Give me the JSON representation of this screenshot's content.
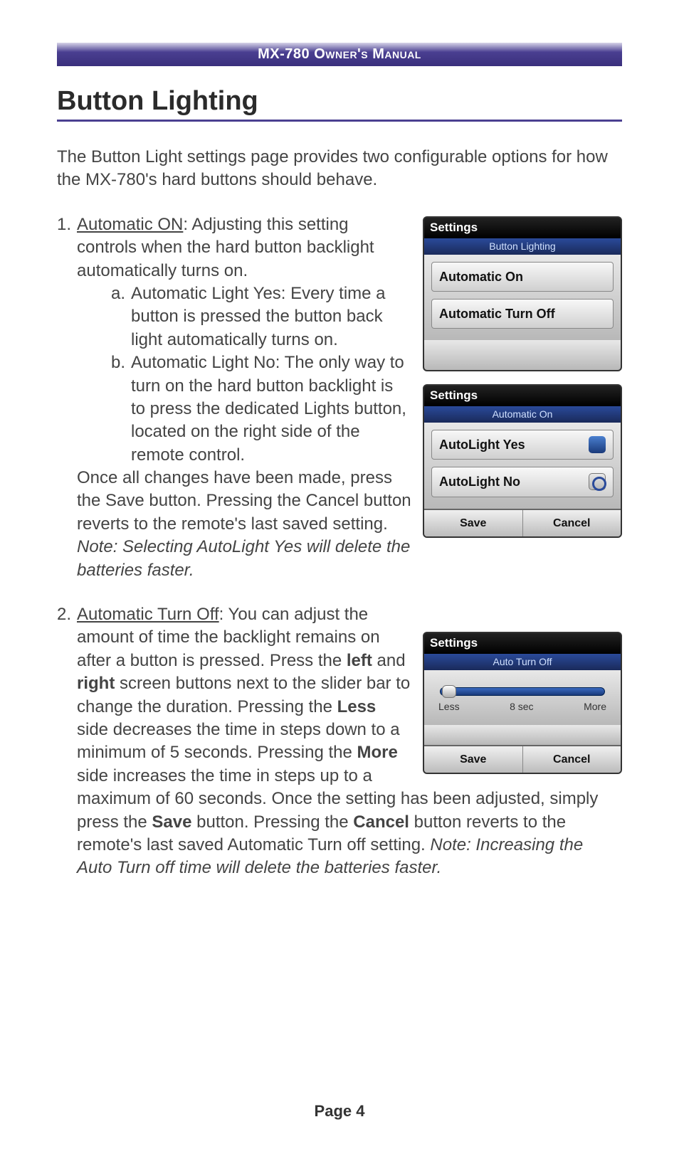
{
  "header": {
    "manual_title": "MX-780 Owner's Manual"
  },
  "section": {
    "title": "Button Lighting"
  },
  "intro": "The Button Light settings page provides two configurable options for how the MX-780's hard buttons should behave.",
  "item1": {
    "num": "1.",
    "lead_underline": "Automatic ON",
    "lead_rest": ": Adjusting this setting controls when the hard button backlight automatically turns on.",
    "sub_a_letter": "a.",
    "sub_a": "Automatic Light Yes: Every time a button is pressed the button back light automatically turns on.",
    "sub_b_letter": "b.",
    "sub_b": "Automatic Light No: The only way to turn on the hard button backlight is to press the dedicated Lights button, located on the right side of the remote control.",
    "tail_plain": "Once all changes have been made, press the Save button. Pressing the Cancel button reverts to the remote's last saved setting. ",
    "tail_italic": "Note: Selecting AutoLight Yes will delete the batteries faster."
  },
  "item2": {
    "num": "2.",
    "lead_underline": "Automatic Turn Off",
    "p1": ": You can adjust the amount of time the backlight remains on after a button is pressed. Press the ",
    "b1": "left",
    "p2": " and ",
    "b2": "right",
    "p3": " screen buttons next to the slider bar to change the duration. Pressing the ",
    "b3": "Less",
    "p4": " side decreases the time in steps down to a minimum of 5 seconds. Pressing the ",
    "b4": "More",
    "p5": " side increases the time in steps up to a maximum of 60 seconds. Once the setting has been adjusted, simply press the ",
    "b5": "Save",
    "p6": " button. Pressing the ",
    "b6": "Cancel",
    "p7": " button reverts to the remote's last saved Automatic Turn off setting. ",
    "italic": "Note: Increasing the Auto Turn off time will delete the batteries faster."
  },
  "screenshot1": {
    "title": "Settings",
    "sub": "Button Lighting",
    "row1": "Automatic On",
    "row2": "Automatic Turn Off"
  },
  "screenshot2": {
    "title": "Settings",
    "sub": "Automatic On",
    "row1": "AutoLight  Yes",
    "row2": "AutoLight  No",
    "save": "Save",
    "cancel": "Cancel"
  },
  "screenshot3": {
    "title": "Settings",
    "sub": "Auto Turn Off",
    "less": "Less",
    "value": "8 sec",
    "more": "More",
    "save": "Save",
    "cancel": "Cancel"
  },
  "footer": {
    "page": "Page 4"
  }
}
